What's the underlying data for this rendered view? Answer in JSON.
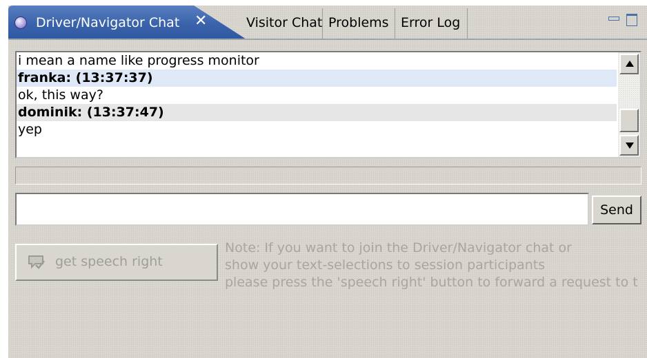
{
  "tabs": {
    "active": {
      "label": "Driver/Navigator Chat",
      "close": "✕"
    },
    "others": [
      "Visitor Chat",
      "Problems",
      "Error Log"
    ]
  },
  "chat": {
    "lines": [
      {
        "text": "i mean a name like progress monitor",
        "style": "message"
      },
      {
        "text": "franka: (13:37:37)",
        "style": "header-blue"
      },
      {
        "text": "ok, this way?",
        "style": "message"
      },
      {
        "text": "dominik: (13:37:47)",
        "style": "header-gray"
      },
      {
        "text": "yep",
        "style": "message"
      }
    ]
  },
  "input": {
    "value": "",
    "placeholder": ""
  },
  "send_label": "Send",
  "speech_button": {
    "label": "get speech right",
    "icon": "speech-bubble-check-icon"
  },
  "note": {
    "lines": [
      "Note: If you want to join the Driver/Navigator chat or",
      "show your text-selections to session participants",
      "please press the 'speech right' button to forward a request to t"
    ]
  },
  "colors": {
    "active_tab": "#3a63ab",
    "header_blue_bg": "#dfe8f6",
    "header_gray_bg": "#e6e6e6",
    "panel_bg": "#d8d6cf",
    "disabled_text": "#a09e98"
  }
}
